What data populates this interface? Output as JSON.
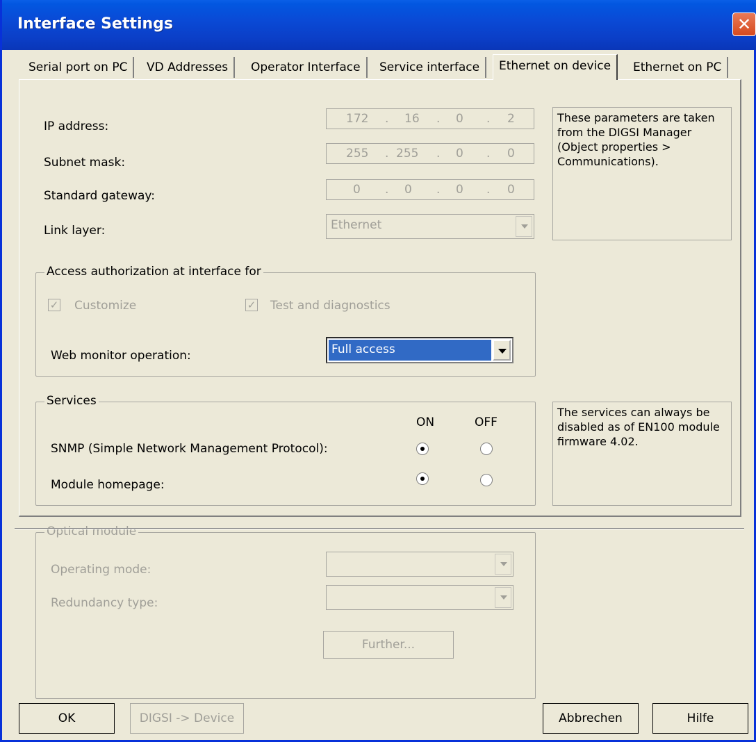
{
  "window": {
    "title": "Interface Settings",
    "close_symbol": "✕"
  },
  "tabs": [
    {
      "label": "Serial port on PC"
    },
    {
      "label": "VD Addresses"
    },
    {
      "label": "Operator Interface"
    },
    {
      "label": "Service interface"
    },
    {
      "label": "Ethernet on device",
      "active": true
    },
    {
      "label": "Ethernet on PC"
    }
  ],
  "network": {
    "ip_label": "IP address:",
    "ip": [
      "172",
      "16",
      "0",
      "2"
    ],
    "subnet_label": "Subnet mask:",
    "subnet": [
      "255",
      "255",
      "0",
      "0"
    ],
    "gateway_label": "Standard gateway:",
    "gateway": [
      "0",
      "0",
      "0",
      "0"
    ],
    "link_label": "Link layer:",
    "link_value": "Ethernet",
    "note": "These parameters are taken from the DIGSI Manager (Object properties > Communications)."
  },
  "access": {
    "title": "Access authorization at interface for",
    "customize_label": "Customize",
    "test_label": "Test and diagnostics",
    "check_symbol": "✓",
    "web_label": "Web monitor operation:",
    "web_value": "Full access"
  },
  "services": {
    "title": "Services",
    "on_label": "ON",
    "off_label": "OFF",
    "snmp_label": "SNMP (Simple Network Management Protocol):",
    "homepage_label": "Module homepage:",
    "note": "The services can always be disabled as of EN100 module firmware 4.02."
  },
  "optical": {
    "title": "Optical module",
    "operating_label": "Operating mode:",
    "redundancy_label": "Redundancy type:",
    "further_label": "Further..."
  },
  "footer": {
    "ok": "OK",
    "digsi": "DIGSI -> Device",
    "cancel": "Abbrechen",
    "help": "Hilfe"
  },
  "colors": {
    "titlebar": "#0a4ad6",
    "highlight": "#316ac5",
    "disabled_text": "#a09f98",
    "dialog_bg": "#ece9d8"
  }
}
